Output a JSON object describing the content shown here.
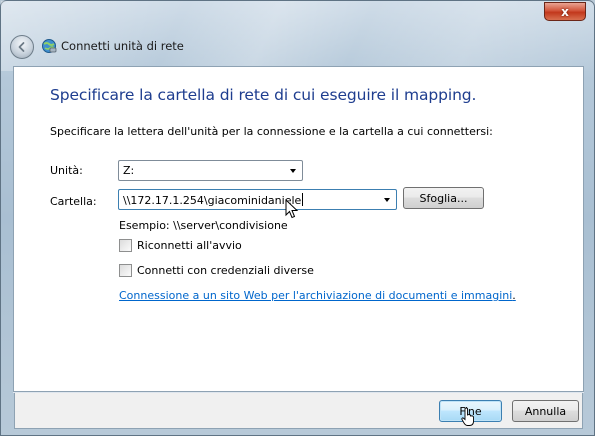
{
  "window": {
    "title": "Connetti unità di rete",
    "close_glyph": "x"
  },
  "content": {
    "heading": "Specificare la cartella di rete di cui eseguire il mapping.",
    "instructions": "Specificare la lettera dell'unità per la connessione e la cartella a cui connettersi:",
    "drive": {
      "label": "Unità:",
      "value": "Z:"
    },
    "folder": {
      "label": "Cartella:",
      "value": "\\\\172.17.1.254\\giacominidaniele",
      "browse_label": "Sfoglia..."
    },
    "example": "Esempio: \\\\server\\condivisione",
    "reconnect_label": "Riconnetti all'avvio",
    "reconnect_checked": false,
    "credentials_label": "Connetti con credenziali diverse",
    "credentials_checked": false,
    "link_text": "Connessione a un sito Web per l'archiviazione di documenti e immagini",
    "link_suffix": "."
  },
  "footer": {
    "finish_label": "Fine",
    "cancel_label": "Annulla"
  },
  "colors": {
    "heading": "#1e3d8f",
    "link": "#0066cc",
    "close_button": "#c2381c"
  }
}
